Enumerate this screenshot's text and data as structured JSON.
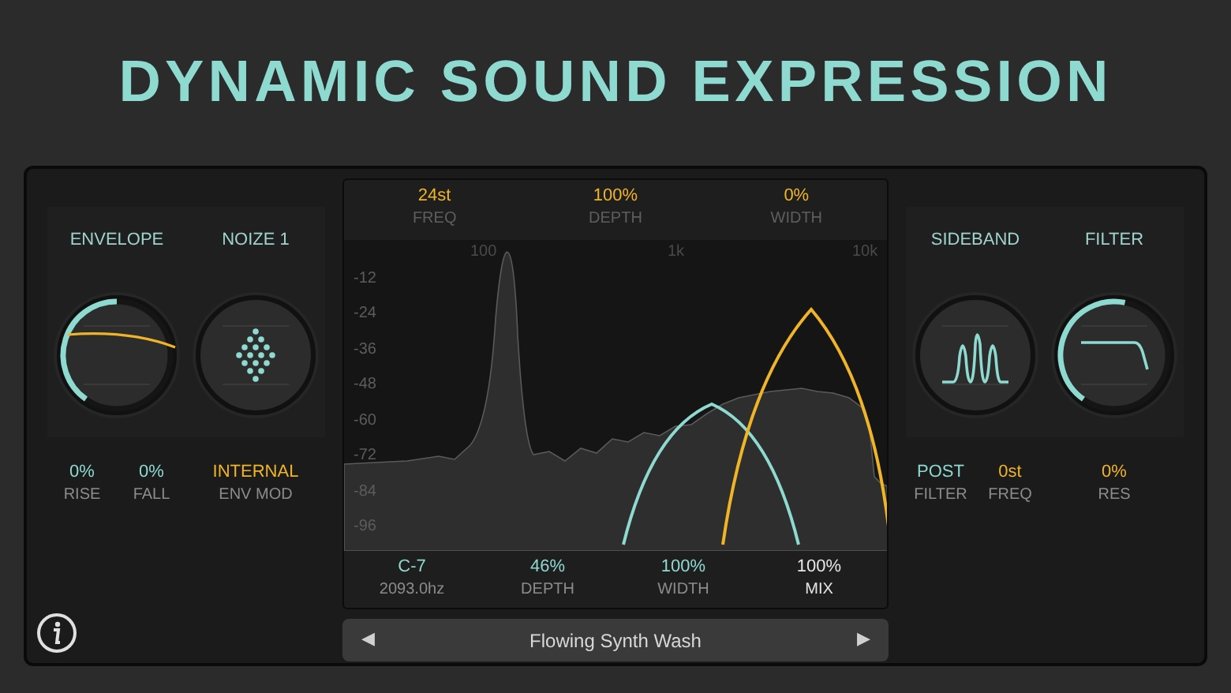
{
  "title": "DYNAMIC SOUND EXPRESSION",
  "left_section": {
    "modules": [
      {
        "label": "ENVELOPE",
        "kind": "envelope",
        "level": 0.5
      },
      {
        "label": "NOIZE 1",
        "kind": "noise"
      }
    ],
    "params": [
      {
        "value": "0%",
        "label": "RISE",
        "color": "#8ed9d0"
      },
      {
        "value": "0%",
        "label": "FALL",
        "color": "#8ed9d0"
      },
      {
        "value": "INTERNAL",
        "label": "ENV MOD",
        "color": "#f0b429"
      }
    ]
  },
  "center_section": {
    "top_params": [
      {
        "value": "24st",
        "label": "FREQ",
        "color": "#f0b429"
      },
      {
        "value": "100%",
        "label": "DEPTH",
        "color": "#f0b429"
      },
      {
        "value": "0%",
        "label": "WIDTH",
        "color": "#f0b429"
      }
    ],
    "spectrum": {
      "y_labels": [
        "-12",
        "-24",
        "-36",
        "-48",
        "-60",
        "-72",
        "-84",
        "-96"
      ],
      "x_labels": [
        "100",
        "1k",
        "10k"
      ]
    },
    "bottom_params": [
      {
        "value": "C-7",
        "label": "2093.0hz",
        "color": "#8ed9d0"
      },
      {
        "value": "46%",
        "label": "DEPTH",
        "color": "#8ed9d0"
      },
      {
        "value": "100%",
        "label": "WIDTH",
        "color": "#8ed9d0"
      },
      {
        "value": "100%",
        "label": "MIX",
        "color": "#e5e5e5"
      }
    ],
    "preset": {
      "prev": "◀",
      "name": "Flowing Synth Wash",
      "next": "▶"
    }
  },
  "right_section": {
    "modules": [
      {
        "label": "SIDEBAND",
        "kind": "sideband"
      },
      {
        "label": "FILTER",
        "kind": "filter",
        "level": 0.6
      }
    ],
    "params": [
      {
        "value": "POST",
        "label": "FILTER",
        "color": "#8ed9d0"
      },
      {
        "value": "0st",
        "label": "FREQ",
        "color": "#f0b429"
      },
      {
        "value": "0%",
        "label": "RES",
        "color": "#f0b429"
      }
    ]
  }
}
